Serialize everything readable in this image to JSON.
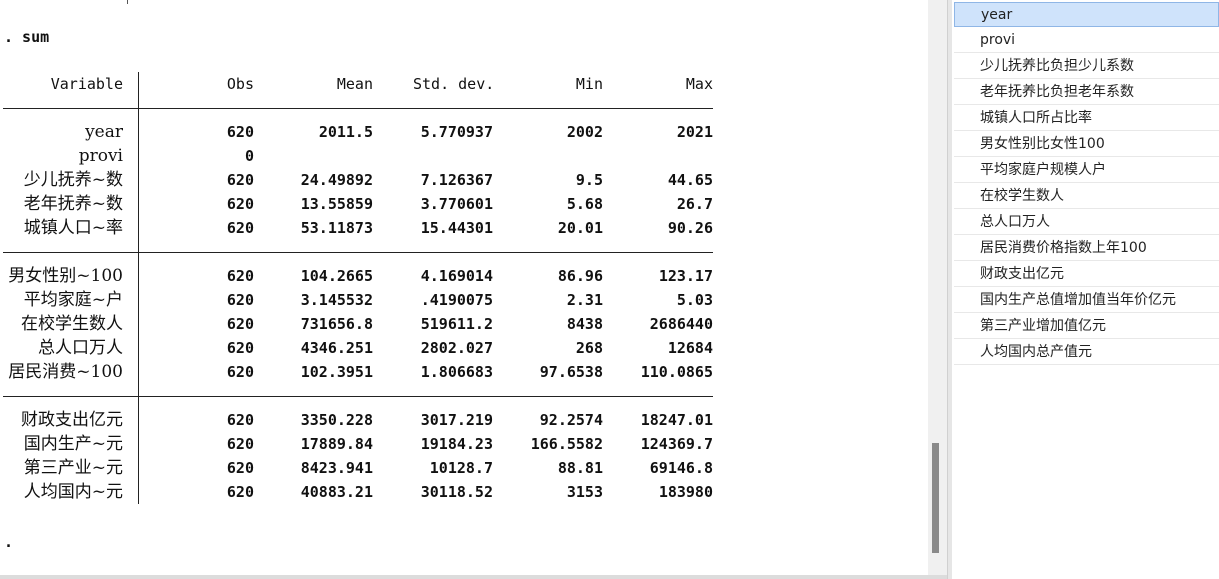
{
  "results": {
    "command": ". sum",
    "prompt": ".",
    "headers": [
      "Variable",
      "Obs",
      "Mean",
      "Std. dev.",
      "Min",
      "Max"
    ],
    "groups": [
      [
        {
          "var": "year",
          "obs": "620",
          "mean": "2011.5",
          "sd": "5.770937",
          "min": "2002",
          "max": "2021"
        },
        {
          "var": "provi",
          "obs": "0",
          "mean": "",
          "sd": "",
          "min": "",
          "max": ""
        },
        {
          "var": "少儿抚养~数",
          "obs": "620",
          "mean": "24.49892",
          "sd": "7.126367",
          "min": "9.5",
          "max": "44.65"
        },
        {
          "var": "老年抚养~数",
          "obs": "620",
          "mean": "13.55859",
          "sd": "3.770601",
          "min": "5.68",
          "max": "26.7"
        },
        {
          "var": "城镇人口~率",
          "obs": "620",
          "mean": "53.11873",
          "sd": "15.44301",
          "min": "20.01",
          "max": "90.26"
        }
      ],
      [
        {
          "var": "男女性别~100",
          "obs": "620",
          "mean": "104.2665",
          "sd": "4.169014",
          "min": "86.96",
          "max": "123.17"
        },
        {
          "var": "平均家庭~户",
          "obs": "620",
          "mean": "3.145532",
          "sd": ".4190075",
          "min": "2.31",
          "max": "5.03"
        },
        {
          "var": "在校学生数人",
          "obs": "620",
          "mean": "731656.8",
          "sd": "519611.2",
          "min": "8438",
          "max": "2686440"
        },
        {
          "var": "总人口万人",
          "obs": "620",
          "mean": "4346.251",
          "sd": "2802.027",
          "min": "268",
          "max": "12684"
        },
        {
          "var": "居民消费~100",
          "obs": "620",
          "mean": "102.3951",
          "sd": "1.806683",
          "min": "97.6538",
          "max": "110.0865"
        }
      ],
      [
        {
          "var": "财政支出亿元",
          "obs": "620",
          "mean": "3350.228",
          "sd": "3017.219",
          "min": "92.2574",
          "max": "18247.01"
        },
        {
          "var": "国内生产~元",
          "obs": "620",
          "mean": "17889.84",
          "sd": "19184.23",
          "min": "166.5582",
          "max": "124369.7"
        },
        {
          "var": "第三产业~元",
          "obs": "620",
          "mean": "8423.941",
          "sd": "10128.7",
          "min": "88.81",
          "max": "69146.8"
        },
        {
          "var": "人均国内~元",
          "obs": "620",
          "mean": "40883.21",
          "sd": "30118.52",
          "min": "3153",
          "max": "183980"
        }
      ]
    ]
  },
  "variables": {
    "selected": "year",
    "items": [
      "year",
      "provi",
      "少儿抚养比负担少儿系数",
      "老年抚养比负担老年系数",
      "城镇人口所占比率",
      "男女性别比女性100",
      "平均家庭户规模人户",
      "在校学生数人",
      "总人口万人",
      "居民消费价格指数上年100",
      "财政支出亿元",
      "国内生产总值增加值当年价亿元",
      "第三产业增加值亿元",
      "人均国内总产值元"
    ]
  },
  "colors": {
    "selection_bg": "#cfe3fb",
    "selection_border": "#8fb6e6",
    "scroll_thumb": "#8a8a8a"
  }
}
